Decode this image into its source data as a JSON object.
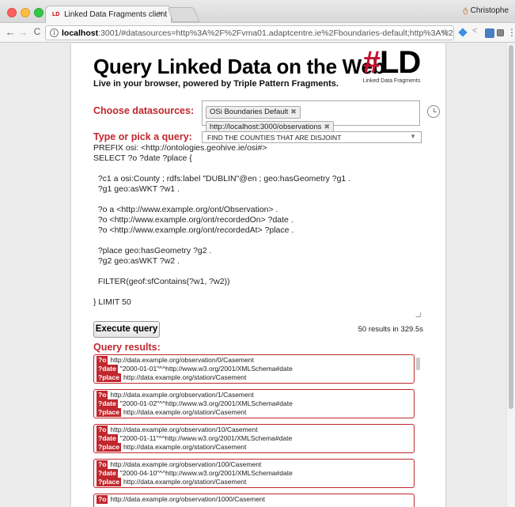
{
  "browser": {
    "tab_title": "Linked Data Fragments client",
    "tab_favicon": "LD",
    "tab_close": "×",
    "profile_name": "Christophe",
    "url_host": "localhost",
    "url_rest": ":3001/#datasources=http%3A%2F%2Fvma01.adaptcentre.ie%2Fboundaries-default;http%3A%2F%..."
  },
  "header": {
    "title": "Query Linked Data on the Web",
    "subtitle": "Live in your browser, powered by Triple Pattern Fragments.",
    "logo_hash": "#",
    "logo_ld": "LD",
    "logo_caption": "Linked Data Fragments"
  },
  "datasources": {
    "label": "Choose datasources:",
    "chips": [
      "OSi Boundaries Default",
      "http://localhost:3000/observations"
    ]
  },
  "query": {
    "label": "Type or pick a query:",
    "selected": "FIND THE COUNTIES THAT ARE DISJOINT",
    "lines": [
      "PREFIX osi: <http://ontologies.geohive.ie/osi#>",
      "SELECT ?o ?date ?place {",
      "",
      "  ?c1 a osi:County ; rdfs:label \"DUBLIN\"@en ; geo:hasGeometry ?g1 .",
      "  ?g1 geo:asWKT ?w1 .",
      "",
      "  ?o a <http://www.example.org/ont/Observation> .",
      "  ?o <http://www.example.org/ont/recordedOn> ?date .",
      "  ?o <http://www.example.org/ont/recordedAt> ?place .",
      "",
      "  ?place geo:hasGeometry ?g2 .",
      "  ?g2 geo:asWKT ?w2 .",
      "",
      "  FILTER(geof:sfContains(?w1, ?w2))",
      "",
      "} LIMIT 50"
    ]
  },
  "execute": {
    "label": "Execute query",
    "summary": "50 results in 329.5s"
  },
  "results": {
    "label": "Query results:",
    "items": [
      {
        "o": "http://data.example.org/observation/0/Casement",
        "date": "\"2000-01-01\"^^http://www.w3.org/2001/XMLSchema#date",
        "place": "http://data.example.org/station/Casement"
      },
      {
        "o": "http://data.example.org/observation/1/Casement",
        "date": "\"2000-01-02\"^^http://www.w3.org/2001/XMLSchema#date",
        "place": "http://data.example.org/station/Casement"
      },
      {
        "o": "http://data.example.org/observation/10/Casement",
        "date": "\"2000-01-11\"^^http://www.w3.org/2001/XMLSchema#date",
        "place": "http://data.example.org/station/Casement"
      },
      {
        "o": "http://data.example.org/observation/100/Casement",
        "date": "\"2000-04-10\"^^http://www.w3.org/2001/XMLSchema#date",
        "place": "http://data.example.org/station/Casement"
      },
      {
        "o": "http://data.example.org/observation/1000/Casement",
        "date": "",
        "place": ""
      }
    ],
    "var_o": "?o",
    "var_date": "?date",
    "var_place": "?place"
  },
  "colors": {
    "accent": "#c1272d"
  }
}
